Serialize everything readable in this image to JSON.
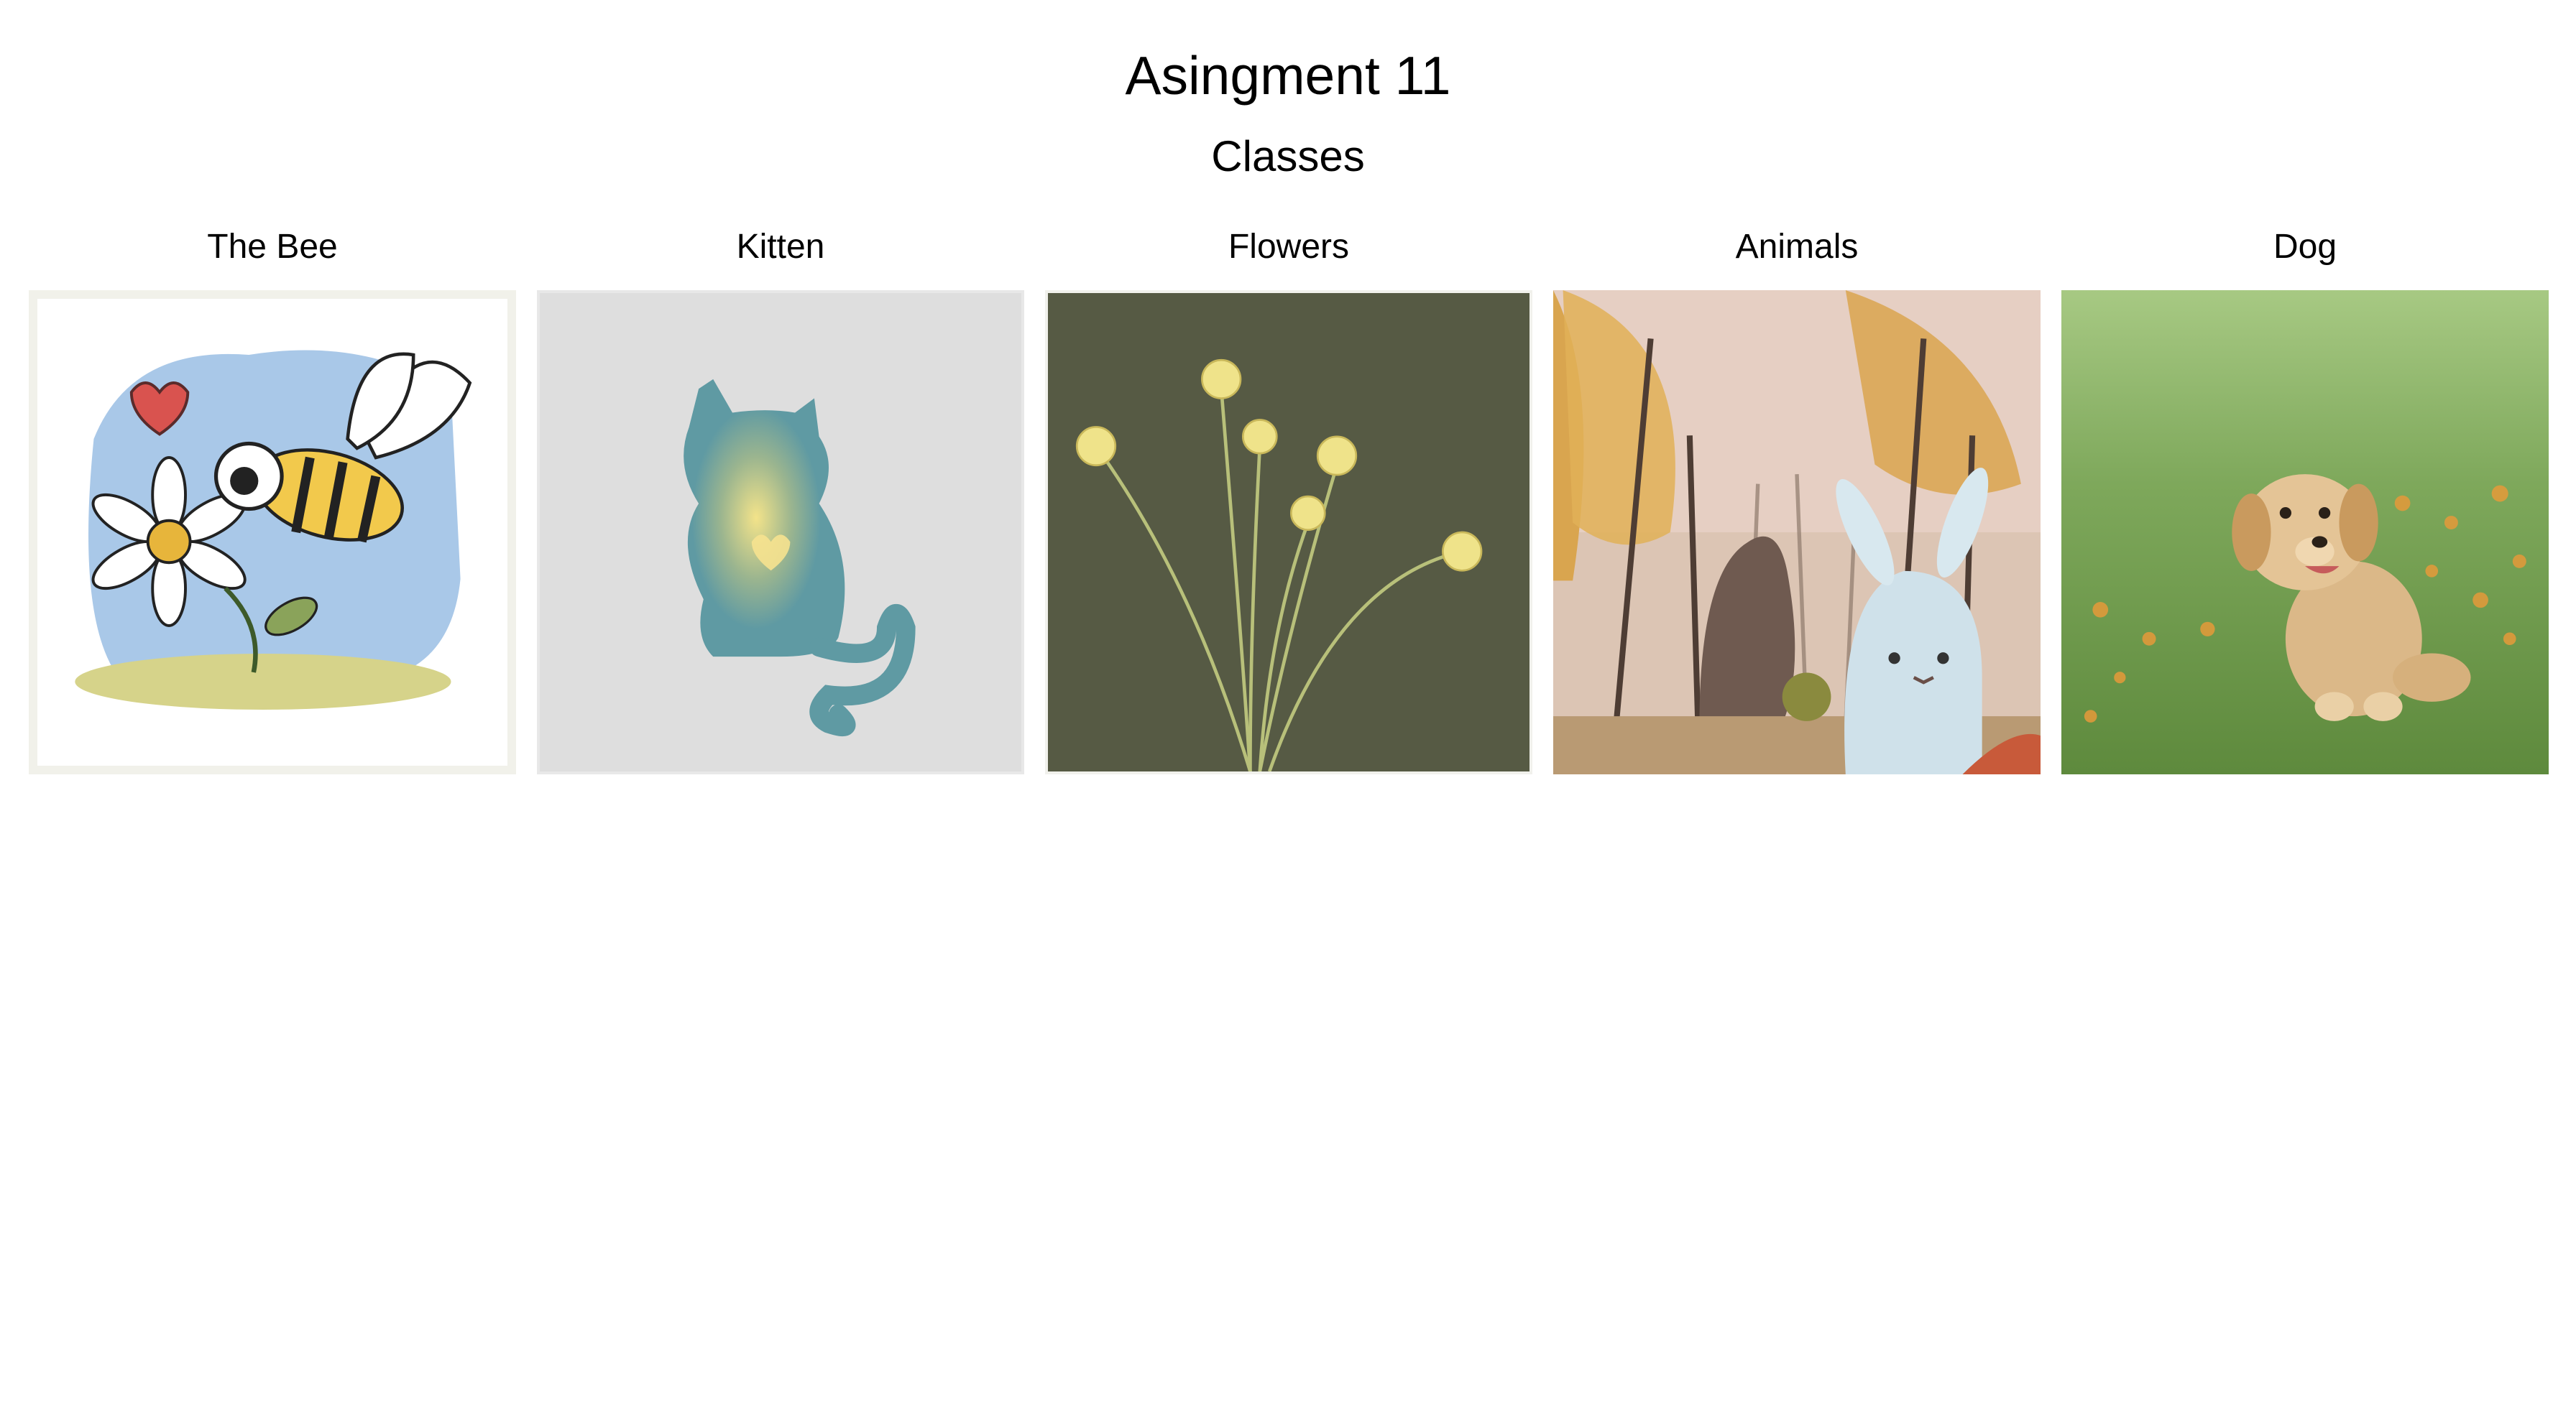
{
  "page": {
    "title": "Asingment 11",
    "subtitle": "Classes"
  },
  "gallery": {
    "items": [
      {
        "label": "The Bee",
        "image": "bee-and-daisy-illustration"
      },
      {
        "label": "Kitten",
        "image": "cat-silhouette-illustration"
      },
      {
        "label": "Flowers",
        "image": "yellow-flowers-illustration"
      },
      {
        "label": "Animals",
        "image": "forest-animals-illustration"
      },
      {
        "label": "Dog",
        "image": "golden-puppy-photo"
      }
    ]
  }
}
